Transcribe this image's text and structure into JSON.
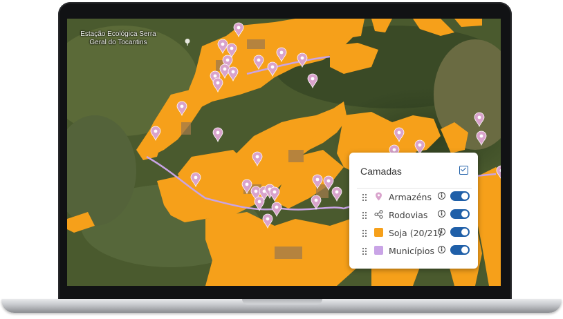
{
  "map": {
    "poi_label": "Estação Ecológica Serra Geral do Tocantins",
    "poi_icon": "tree-icon",
    "marker_color": "#d9a3cc",
    "soy_color": "#f6a01a",
    "road_color": "#c9a4e6"
  },
  "layers_panel": {
    "title": "Camadas",
    "all_checked": true,
    "layers": [
      {
        "label": "Armazéns",
        "icon": "map-pin-icon",
        "enabled": true
      },
      {
        "label": "Rodovias",
        "icon": "share-nodes-icon",
        "enabled": true
      },
      {
        "label": "Soja (20/21)",
        "icon": "orange-square-swatch",
        "color": "#f6a01a",
        "enabled": true
      },
      {
        "label": "Municípios",
        "icon": "violet-square-swatch",
        "color": "#c9a4e6",
        "enabled": true
      }
    ]
  }
}
